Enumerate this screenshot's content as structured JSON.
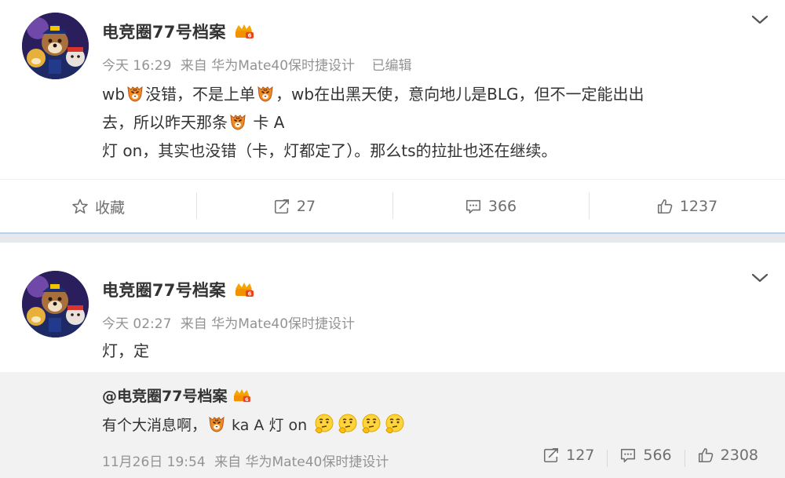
{
  "posts": [
    {
      "username": "电竞圈77号档案",
      "time": "今天 16:29",
      "source": "来自 华为Mate40保时捷设计",
      "edited": "已编辑",
      "content": {
        "l1a": "wb",
        "l1b": "没错，不是上单",
        "l1c": "，wb在出黑天使，意向地儿是BLG，但不一定能出出",
        "l2a": "去，所以昨天那条",
        "l2b": " 卡 A",
        "l3": "灯 on，其实也没错（卡，灯都定了）。那么ts的拉扯也还在继续。"
      },
      "actions": {
        "favorite_label": "收藏",
        "repost_count": "27",
        "comment_count": "366",
        "like_count": "1237"
      }
    },
    {
      "username": "电竞圈77号档案",
      "time": "今天 02:27",
      "source": "来自 华为Mate40保时捷设计",
      "content": "灯，定",
      "repost": {
        "user": "@电竞圈77号档案",
        "text_a": "有个大消息啊，",
        "text_b": " ka A 灯 on",
        "time": "11月26日 19:54",
        "source": "来自 华为Mate40保时捷设计",
        "repost_count": "127",
        "comment_count": "566",
        "like_count": "2308"
      }
    }
  ],
  "icons": {
    "emoji": "tiger-face-emoji",
    "thinking": "thinking-face-emoji",
    "badge": "vip-badge-icon",
    "chevron": "chevron-down-icon",
    "star": "star-icon",
    "repost": "repost-icon",
    "comment": "comment-icon",
    "like": "thumbs-up-icon"
  },
  "colors": {
    "separator": "#e5e9ee",
    "separator_accent": "#b6d2ea",
    "meta_text": "#939393",
    "repost_bg": "#f2f2f2"
  }
}
